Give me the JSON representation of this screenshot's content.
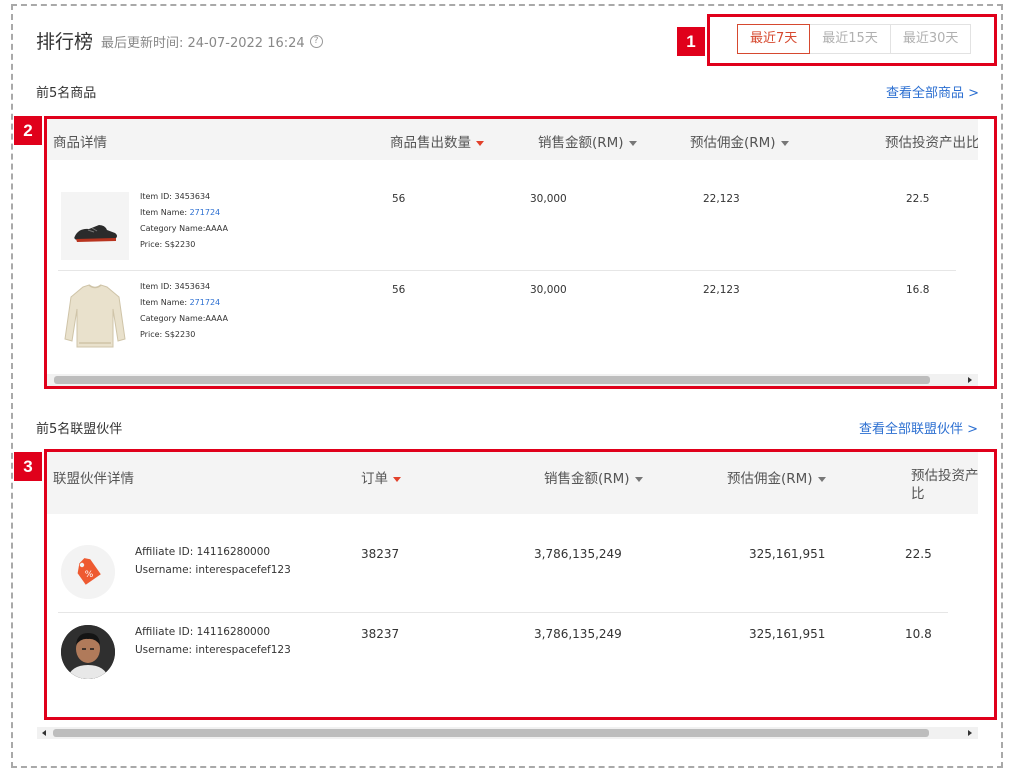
{
  "header": {
    "title": "排行榜",
    "updated_label": "最后更新时间: 24-07-2022 16:24",
    "help_icon": "question-circle-icon"
  },
  "ranges": {
    "options": [
      "最近7天",
      "最近15天",
      "最近30天"
    ],
    "selected": "最近7天",
    "active_color": "#d6492f"
  },
  "annotations": {
    "badges": [
      "1",
      "2",
      "3"
    ],
    "color": "#e0001b"
  },
  "products": {
    "section_title": "前5名商品",
    "view_all": "查看全部商品 >",
    "columns": [
      "商品详情",
      "商品售出数量",
      "销售金额(RM)",
      "预估佣金(RM)",
      "预估投资产出比"
    ],
    "rows": [
      {
        "image": "shoe-image",
        "item_id": "Item ID: 3453634",
        "name_label": "Item Name: ",
        "name_value": "271724",
        "category": "Category Name:AAAA",
        "price": "Price: S$2230",
        "sold": "56",
        "sales": "30,000",
        "commission": "22,123",
        "roi": "22.5"
      },
      {
        "image": "sweater-image",
        "item_id": "Item ID: 3453634",
        "name_label": "Item Name: ",
        "name_value": "271724",
        "category": "Category Name:AAAA",
        "price": "Price: S$2230",
        "sold": "56",
        "sales": "30,000",
        "commission": "22,123",
        "roi": "16.8"
      }
    ]
  },
  "affiliates": {
    "section_title": "前5名联盟伙伴",
    "view_all": "查看全部联盟伙伴 >",
    "columns": [
      "联盟伙伴详情",
      "订单",
      "销售金额(RM)",
      "预估佣金(RM)",
      "预估投资产出",
      "比"
    ],
    "rows": [
      {
        "avatar": "brand-logo-avatar",
        "affiliate_id": "Affiliate ID: 14116280000",
        "username": "Username: interespacefef123",
        "orders": "38237",
        "sales": "3,786,135,249",
        "commission": "325,161,951",
        "roi": "22.5"
      },
      {
        "avatar": "person-avatar",
        "affiliate_id": "Affiliate ID: 14116280000",
        "username": "Username: interespacefef123",
        "orders": "38237",
        "sales": "3,786,135,249",
        "commission": "325,161,951",
        "roi": "10.8"
      }
    ]
  }
}
